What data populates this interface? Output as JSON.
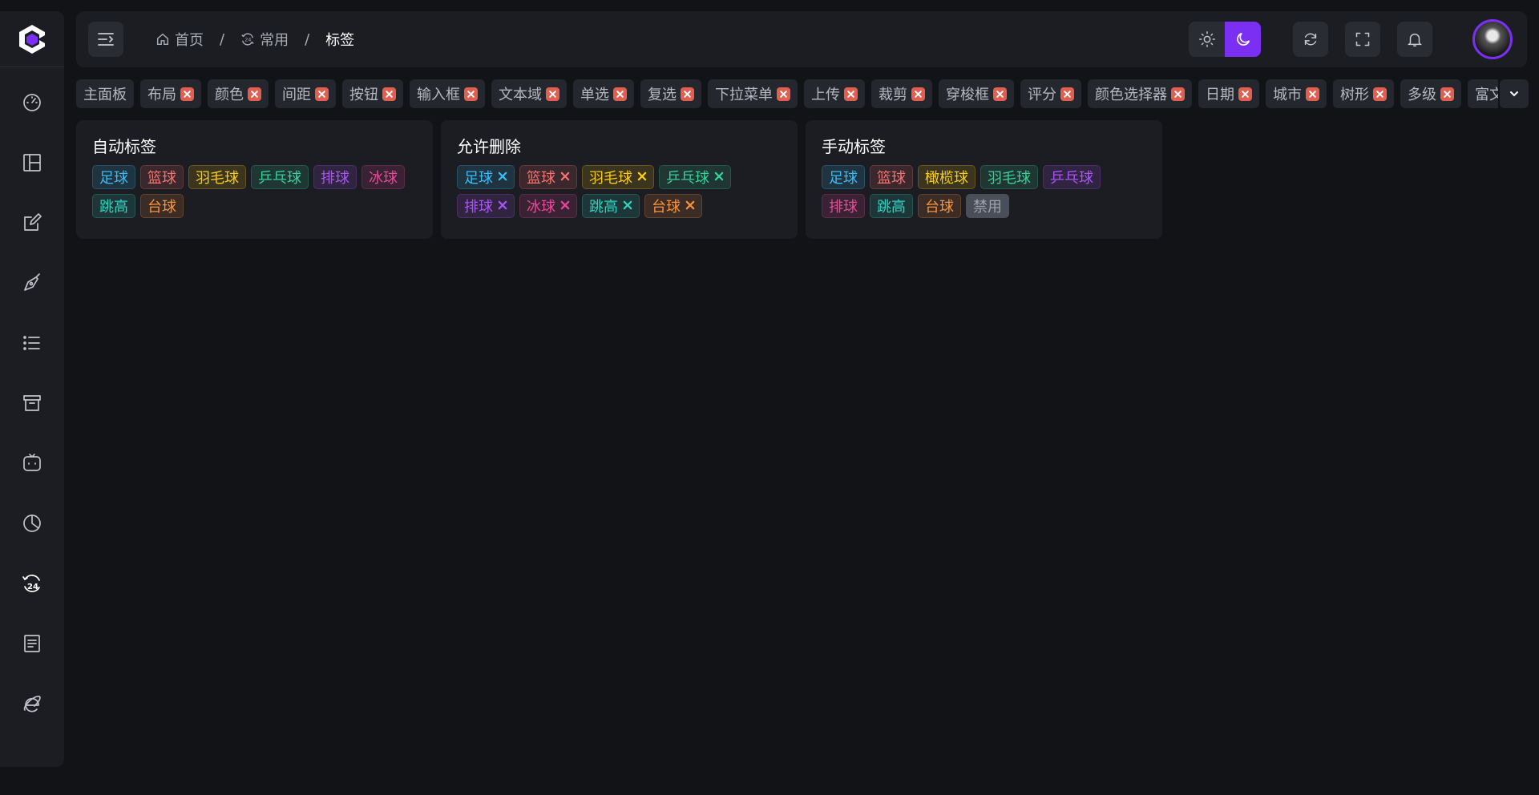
{
  "sidebar": {
    "logo_icon": "logo-c-icon",
    "items": [
      {
        "icon": "dashboard-gauge-icon"
      },
      {
        "icon": "layout-icon"
      },
      {
        "icon": "edit-form-icon"
      },
      {
        "icon": "pen-nib-icon"
      },
      {
        "icon": "list-icon"
      },
      {
        "icon": "archive-box-icon"
      },
      {
        "icon": "chat-bot-icon"
      },
      {
        "icon": "pie-chart-icon"
      },
      {
        "icon": "clock-24-icon",
        "active": true
      },
      {
        "icon": "document-icon"
      },
      {
        "icon": "internet-explorer-icon"
      }
    ]
  },
  "header": {
    "breadcrumb": [
      {
        "label": "首页",
        "icon": "home-icon"
      },
      {
        "label": "常用",
        "icon": "clock-24-icon"
      },
      {
        "label": "标签"
      }
    ],
    "separator": "/"
  },
  "tabs": [
    {
      "label": "主面板",
      "closable": false
    },
    {
      "label": "布局",
      "closable": true
    },
    {
      "label": "颜色",
      "closable": true
    },
    {
      "label": "间距",
      "closable": true
    },
    {
      "label": "按钮",
      "closable": true
    },
    {
      "label": "输入框",
      "closable": true
    },
    {
      "label": "文本域",
      "closable": true
    },
    {
      "label": "单选",
      "closable": true
    },
    {
      "label": "复选",
      "closable": true
    },
    {
      "label": "下拉菜单",
      "closable": true
    },
    {
      "label": "上传",
      "closable": true
    },
    {
      "label": "裁剪",
      "closable": true
    },
    {
      "label": "穿梭框",
      "closable": true
    },
    {
      "label": "评分",
      "closable": true
    },
    {
      "label": "颜色选择器",
      "closable": true
    },
    {
      "label": "日期",
      "closable": true
    },
    {
      "label": "城市",
      "closable": true
    },
    {
      "label": "树形",
      "closable": true
    },
    {
      "label": "多级",
      "closable": true
    },
    {
      "label": "富文本",
      "closable": true
    }
  ],
  "colors": {
    "blue": "#38bdf8",
    "red": "#f87171",
    "yellow": "#facc15",
    "green": "#34d399",
    "purple": "#a855f7",
    "pink": "#ec4899",
    "teal": "#2dd4bf",
    "orange": "#fb923c",
    "accent": "#7b2ff2"
  },
  "cards": [
    {
      "title": "自动标签",
      "tags": [
        {
          "label": "足球",
          "color": "blue"
        },
        {
          "label": "篮球",
          "color": "red"
        },
        {
          "label": "羽毛球",
          "color": "yellow"
        },
        {
          "label": "乒乓球",
          "color": "green"
        },
        {
          "label": "排球",
          "color": "purple"
        },
        {
          "label": "冰球",
          "color": "pink"
        },
        {
          "label": "跳高",
          "color": "teal"
        },
        {
          "label": "台球",
          "color": "orange"
        }
      ]
    },
    {
      "title": "允许删除",
      "tags": [
        {
          "label": "足球",
          "color": "blue",
          "closable": true
        },
        {
          "label": "篮球",
          "color": "red",
          "closable": true
        },
        {
          "label": "羽毛球",
          "color": "yellow",
          "closable": true
        },
        {
          "label": "乒乓球",
          "color": "green",
          "closable": true
        },
        {
          "label": "排球",
          "color": "purple",
          "closable": true
        },
        {
          "label": "冰球",
          "color": "pink",
          "closable": true
        },
        {
          "label": "跳高",
          "color": "teal",
          "closable": true
        },
        {
          "label": "台球",
          "color": "orange",
          "closable": true
        }
      ]
    },
    {
      "title": "手动标签",
      "tags": [
        {
          "label": "足球",
          "color": "blue"
        },
        {
          "label": "篮球",
          "color": "red"
        },
        {
          "label": "橄榄球",
          "color": "yellow"
        },
        {
          "label": "羽毛球",
          "color": "green"
        },
        {
          "label": "乒乓球",
          "color": "purple"
        },
        {
          "label": "排球",
          "color": "pink"
        },
        {
          "label": "跳高",
          "color": "teal"
        },
        {
          "label": "台球",
          "color": "orange"
        },
        {
          "label": "禁用",
          "disabled": true
        }
      ]
    }
  ]
}
